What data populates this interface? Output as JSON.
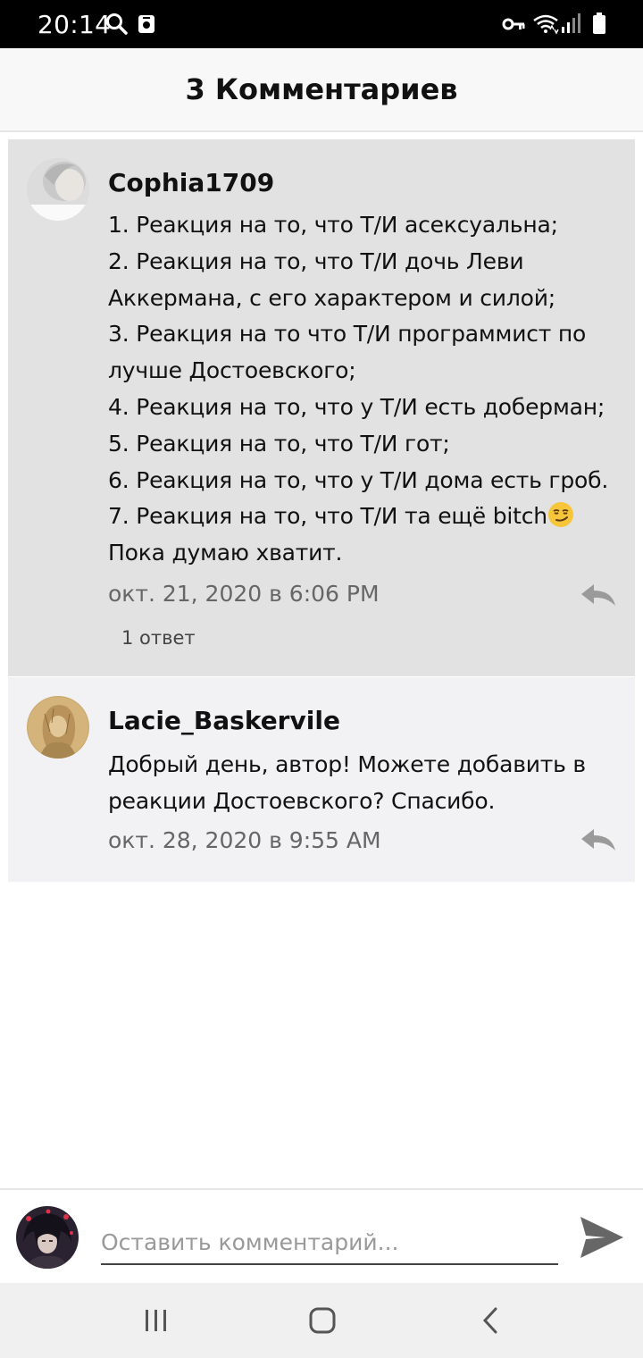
{
  "status_bar": {
    "time": "20:14",
    "icons": [
      "search-icon",
      "app-notification-icon",
      "vpn-key-icon",
      "wifi-icon",
      "signal-icon",
      "battery-icon"
    ]
  },
  "header": {
    "title": "3 Комментариев"
  },
  "comments": [
    {
      "author": "Cophia1709",
      "avatar": "avatar-photo",
      "lines": [
        "1. Реакция на то, что Т/И асексуальна;",
        "2. Реакция на то, что Т/И дочь Леви",
        "Аккермана, с его характером и силой;",
        "3. Реакция на то что Т/И программист по",
        "лучше Достоевского;",
        "4. Реакция на то, что у Т/И есть доберман;",
        "5. Реакция на то, что Т/И гот;",
        "6. Реакция на то, что у Т/И дома есть гроб.",
        "7. Реакция на то, что Т/И та ещё bitch",
        "Пока думаю хватит."
      ],
      "emoji": "smirking-face-emoji",
      "timestamp": "окт. 21, 2020 в 6:06 PM",
      "replies_label": "1 ответ"
    },
    {
      "author": "Lacie_Baskervile",
      "avatar": "avatar-drawing",
      "lines": [
        "Добрый день, автор! Можете добавить в",
        "реакции Достоевского? Спасибо."
      ],
      "timestamp": "окт. 28, 2020 в 9:55 AM"
    }
  ],
  "composer": {
    "placeholder": "Оставить комментарий...",
    "value": "",
    "send_icon": "send-icon"
  },
  "nav_bar": {
    "buttons": [
      "recent-apps-icon",
      "home-icon",
      "back-icon"
    ]
  },
  "colors": {
    "highlight_comment_bg": "#e2e2e2",
    "comment_bg": "#f2f2f4",
    "timestamp": "#666666",
    "icon_gray": "#9a9a9a"
  }
}
